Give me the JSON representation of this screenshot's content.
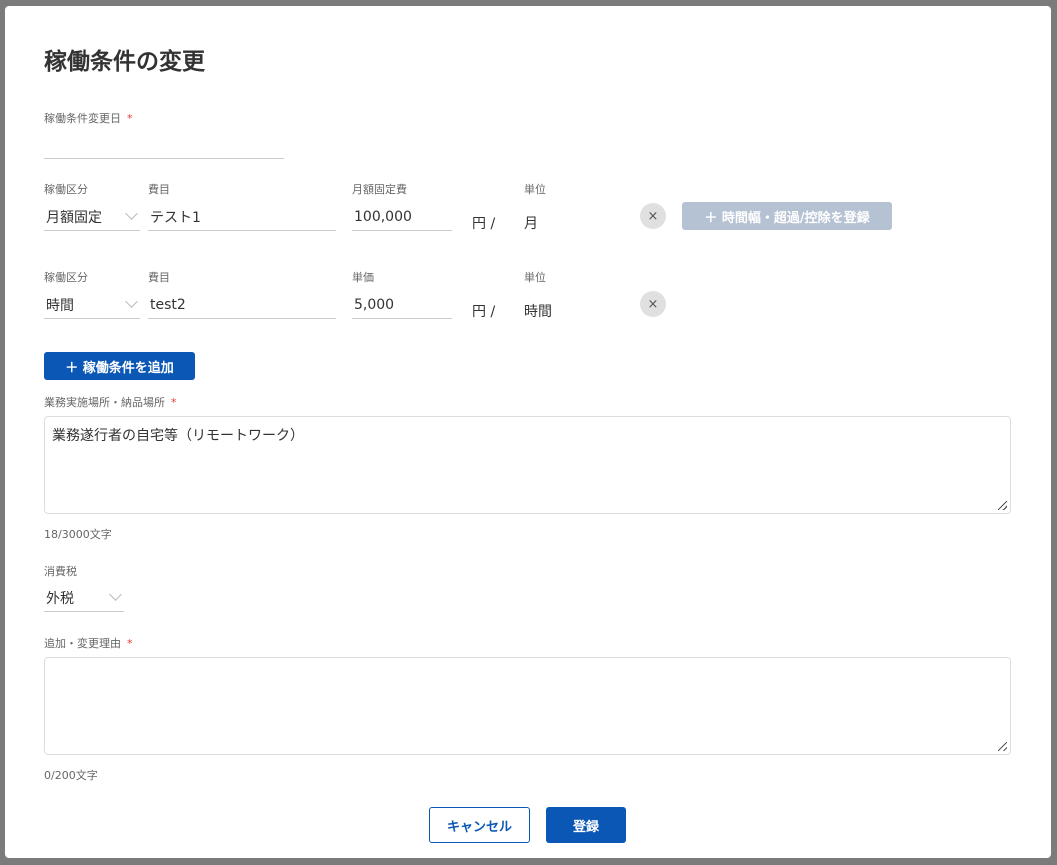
{
  "title": "稼働条件の変更",
  "change_date": {
    "label": "稼働条件変更日",
    "required": "*",
    "value": ""
  },
  "rows": [
    {
      "type_label": "稼働区分",
      "type_value": "月額固定",
      "item_label": "費目",
      "item_value": "テスト1",
      "amount_label": "月額固定費",
      "amount_value": "100,000",
      "currency": "円 /",
      "unit_label": "単位",
      "unit_value": "月",
      "remove": "×",
      "extra_button": "＋ 時間幅・超過/控除を登録"
    },
    {
      "type_label": "稼働区分",
      "type_value": "時間",
      "item_label": "費目",
      "item_value": "test2",
      "amount_label": "単価",
      "amount_value": "5,000",
      "currency": "円 /",
      "unit_label": "単位",
      "unit_value": "時間",
      "remove": "×"
    }
  ],
  "add_condition": "＋ 稼働条件を追加",
  "location": {
    "label": "業務実施場所・納品場所",
    "required": "*",
    "value": "業務遂行者の自宅等（リモートワーク）",
    "count": "18/3000文字"
  },
  "tax": {
    "label": "消費税",
    "value": "外税"
  },
  "reason": {
    "label": "追加・変更理由",
    "required": "*",
    "value": "",
    "count": "0/200文字"
  },
  "buttons": {
    "cancel": "キャンセル",
    "submit": "登録"
  },
  "colors": {
    "primary": "#0b57b5",
    "disabled": "#b5c2d3",
    "required": "#e53935"
  }
}
